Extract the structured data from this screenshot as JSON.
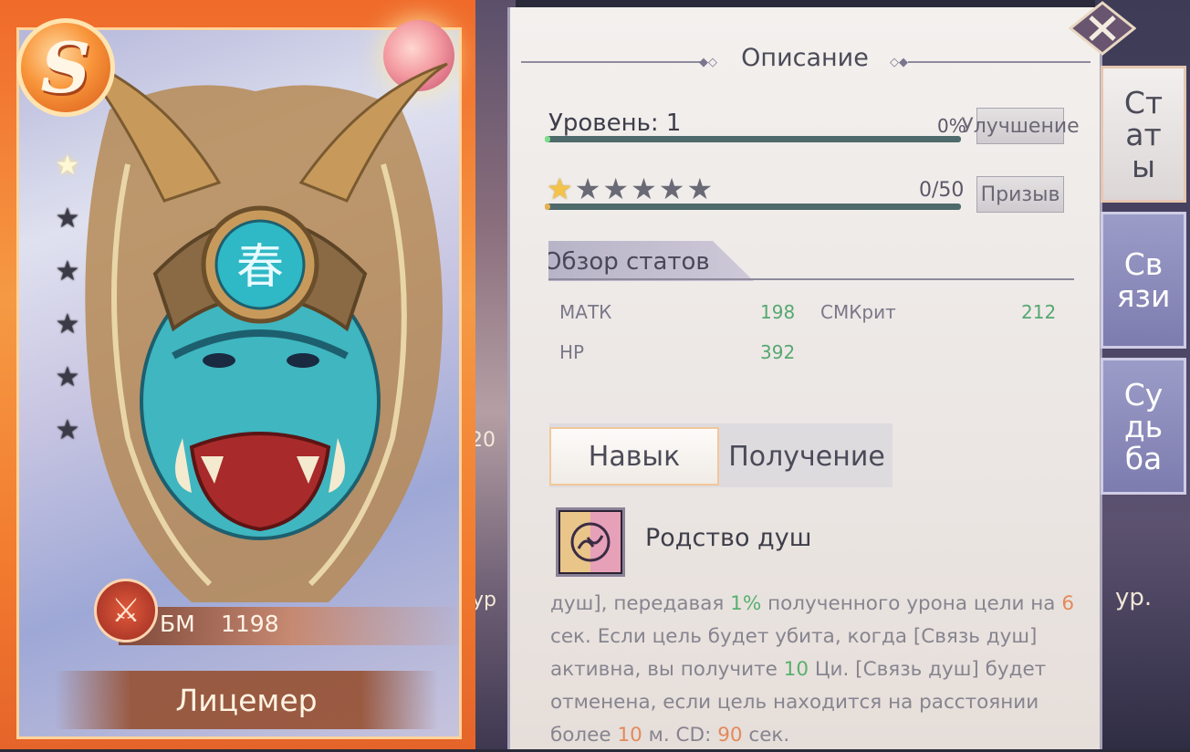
{
  "card": {
    "rank": "S",
    "stars_total": 6,
    "stars_filled": 1,
    "bm_label": "БМ",
    "bm_value": "1198",
    "hero_name": "Лицемер"
  },
  "panel": {
    "title": "Описание",
    "level_label": "Уровень: 1",
    "level_progress_pct": "0%",
    "level_progress_fraction": 0.01,
    "upgrade_button": "Улучшение",
    "stars_total": 6,
    "stars_filled": 1,
    "shards_count": "0/50",
    "shards_fraction": 0.0,
    "summon_button": "Призыв",
    "stats_overview_title": "Обзор статов",
    "stats": [
      {
        "label": "МАТК",
        "value": "198"
      },
      {
        "label": "СМКрит",
        "value": "212"
      },
      {
        "label": "HP",
        "value": "392"
      }
    ],
    "tabs": {
      "skill": "Навык",
      "obtain": "Получение"
    },
    "skill": {
      "name": "Родство душ",
      "desc_parts": [
        "душ], передавая ",
        "1%",
        " полученного урона цели на ",
        "6",
        " сек. Если цель будет убита, когда [Связь душ] активна, вы получите ",
        "10",
        " Ци. [Связь душ] будет отменена, если цель находится на расстоянии более ",
        "10",
        " м. CD: ",
        "90",
        " сек."
      ]
    }
  },
  "side_tabs": [
    {
      "label": "Ст ат ы",
      "active": true
    },
    {
      "label": "Св язи",
      "active": false
    },
    {
      "label": "Су дь ба",
      "active": false
    }
  ],
  "background": {
    "left_fragment_top": "20",
    "left_fragment_bottom": "ур",
    "right_fragment": "ур."
  },
  "colors": {
    "stat_value": "#56a870",
    "highlight_green": "#58b070",
    "highlight_orange": "#e38a5a",
    "card_frame": "#f27b2f"
  },
  "icons": {
    "close": "close-x-icon",
    "bm": "crossed-swords-icon",
    "skill": "soul-kinship-skill-icon",
    "stars": "star-icon"
  }
}
